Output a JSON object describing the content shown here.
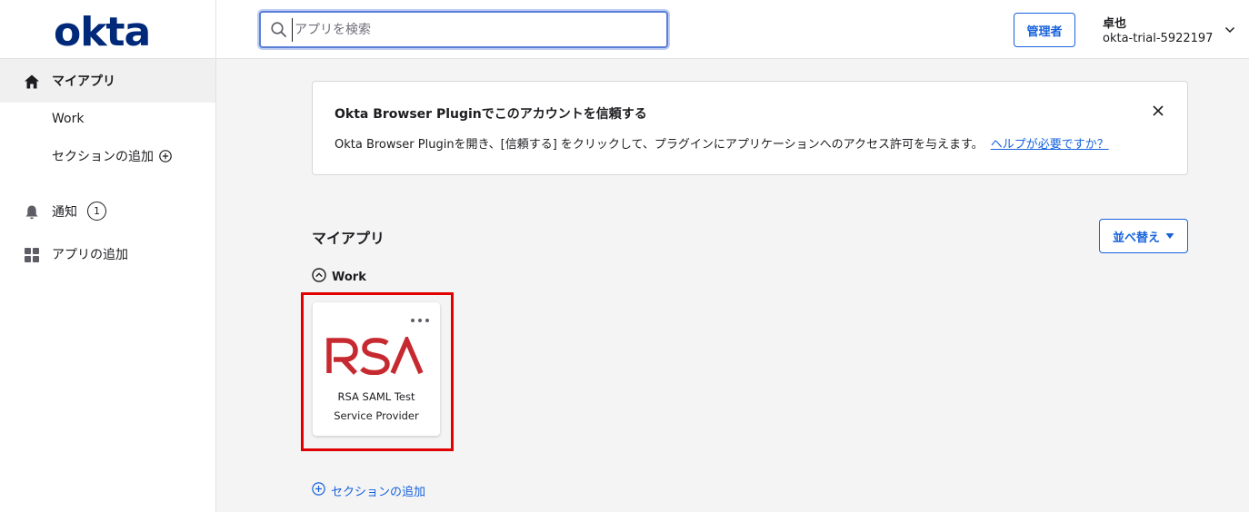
{
  "brand": {
    "logo_text": "okta",
    "logo_color": "#00297a",
    "accent": "#1662dd",
    "highlight": "#e00000"
  },
  "sidebar": {
    "items": [
      {
        "label": "マイアプリ",
        "icon": "home-icon",
        "active": true
      },
      {
        "label": "Work"
      },
      {
        "label": "セクションの追加",
        "icon": "plus-circle-icon"
      },
      {
        "label": "通知",
        "icon": "bell-icon",
        "badge": "1"
      },
      {
        "label": "アプリの追加",
        "icon": "grid-icon"
      }
    ]
  },
  "header": {
    "search": {
      "placeholder": "アプリを検索",
      "icon": "search-icon"
    },
    "admin_label": "管理者",
    "user": {
      "name": "卓也",
      "org": "okta-trial-5922197",
      "icon": "chevron-down-icon"
    }
  },
  "banner": {
    "title": "Okta Browser Pluginでこのアカウントを信頼する",
    "body": "Okta Browser Pluginを開き、[信頼する] をクリックして、プラグインにアプリケーションへのアクセス許可を与えます。",
    "link": "ヘルプが必要ですか？",
    "close_icon": "close-icon"
  },
  "main": {
    "section_title": "マイアプリ",
    "sort_label": "並べ替え",
    "work_label": "Work",
    "apps": [
      {
        "logo_text": "RSA",
        "name_line1": "RSA SAML Test",
        "name_line2": "Service Provider",
        "logo_color": "#c62a30"
      }
    ],
    "add_section_label": "セクションの追加"
  }
}
